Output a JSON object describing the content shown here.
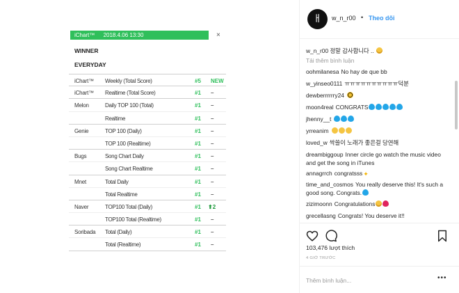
{
  "chart_image": {
    "header_source": "iChart™",
    "header_datetime": "2018.4.06 13:30",
    "close_symbol": "×",
    "artist": "WINNER",
    "song": "EVERYDAY",
    "rows": [
      {
        "service": "iChart™",
        "category": "Weekly (Total Score)",
        "rank": "#5",
        "change": "NEW"
      },
      {
        "service": "iChart™",
        "category": "Realtime (Total Score)",
        "rank": "#1",
        "change": "–"
      },
      {
        "service": "Melon",
        "category": "Daily TOP 100 (Total)",
        "rank": "#1",
        "change": "–"
      },
      {
        "service": "",
        "category": "Realtime",
        "rank": "#1",
        "change": "–"
      },
      {
        "service": "Genie",
        "category": "TOP 100 (Daily)",
        "rank": "#1",
        "change": "–"
      },
      {
        "service": "",
        "category": "TOP 100 (Realtime)",
        "rank": "#1",
        "change": "–"
      },
      {
        "service": "Bugs",
        "category": "Song Chart Daily",
        "rank": "#1",
        "change": "–"
      },
      {
        "service": "",
        "category": "Song Chart Realtime",
        "rank": "#1",
        "change": "–"
      },
      {
        "service": "Mnet",
        "category": "Total Daily",
        "rank": "#1",
        "change": "–"
      },
      {
        "service": "",
        "category": "Total Realtime",
        "rank": "#1",
        "change": "–"
      },
      {
        "service": "Naver",
        "category": "TOP100 Total (Daily)",
        "rank": "#1",
        "change": "⬆2"
      },
      {
        "service": "",
        "category": "TOP100 Total (Realtime)",
        "rank": "#1",
        "change": "–"
      },
      {
        "service": "Soribada",
        "category": "Total (Daily)",
        "rank": "#1",
        "change": "–"
      },
      {
        "service": "",
        "category": "Total (Realtime)",
        "rank": "#1",
        "change": "–"
      }
    ]
  },
  "post": {
    "avatar_glyph": "ㅐ",
    "owner": "w_n_r00",
    "dot": "•",
    "follow_label": "Theo dõi",
    "caption_user": "w_n_r00",
    "caption_text": "정말 감사합니다 ..",
    "load_more": "Tải thêm bình luận",
    "comments": [
      {
        "user": "oohmilanesa",
        "text": "No hay de que bb",
        "emoji": []
      },
      {
        "user": "w_yinseo0111",
        "text": "ㅠㅠㅠㅠㅠㅠㅠㅠㅠㅠ덕분",
        "emoji": []
      },
      {
        "user": "dewberrrrrry24",
        "text": "",
        "emoji": [
          "bee"
        ]
      },
      {
        "user": "moon4real",
        "text": "CONGRATS",
        "emoji": [
          "heart-blue",
          "heart-blue",
          "heart-blue",
          "heart-blue",
          "heart-blue"
        ]
      },
      {
        "user": "jhenny__t",
        "text": "",
        "emoji": [
          "heart-blue",
          "heart-blue",
          "heart-blue"
        ]
      },
      {
        "user": "yrreanim",
        "text": "",
        "emoji": [
          "clap",
          "clap",
          "clap"
        ]
      },
      {
        "user": "loved_w",
        "text": "싹쓸이 노래가 좋은걸 당연해",
        "emoji": []
      },
      {
        "user": "dreambiggoup",
        "text": "Inner circle go watch the music video and get the song in iTunes",
        "emoji": []
      },
      {
        "user": "annagrrch",
        "text": "congratsss",
        "emoji": [
          "sparkle"
        ]
      },
      {
        "user": "time_and_cosmos",
        "text": "You really deserve this! It's such a good song. Congrats.",
        "emoji": [
          "heart-blue"
        ]
      },
      {
        "user": "zizimoonn",
        "text": "Congratulations",
        "emoji": [
          "face",
          "heart-red"
        ]
      },
      {
        "user": "grecellasng",
        "text": "Congrats! You deserve it!!",
        "emoji": []
      }
    ],
    "likes": "103,476 lượt thích",
    "time_ago": "4 GIỜ TRƯỚC",
    "add_comment_placeholder": "Thêm bình luận...",
    "more_options": "•••"
  },
  "colors": {
    "chart_green": "#2fbf5b",
    "follow_blue": "#3897f0",
    "heart_blue": "#23a6e8"
  },
  "icons": [
    "heart-outline-icon",
    "comment-icon",
    "bookmark-icon",
    "more-options-icon"
  ]
}
